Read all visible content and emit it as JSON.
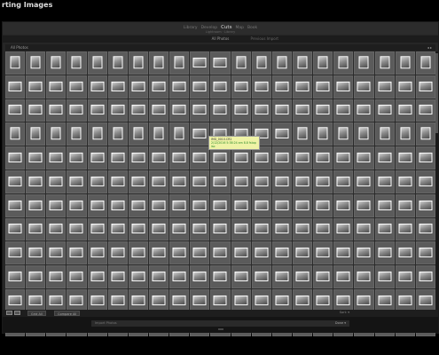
{
  "page": {
    "title": "rting Images"
  },
  "window": {
    "modes": [
      "Library",
      "Develop",
      "Cuts",
      "Map",
      "Book"
    ],
    "active_mode_index": 2,
    "subline": "Lightroom · Library",
    "tabs": [
      "All Photos",
      "Previous Import"
    ],
    "panel_label": "All Photos",
    "panel_control": "◂ ▸"
  },
  "grid": {
    "columns": 21,
    "rows": 12,
    "orientation_rows": [
      "portrait",
      "landscape",
      "landscape",
      "portrait",
      "landscape",
      "landscape",
      "landscape",
      "landscape",
      "landscape",
      "landscape",
      "landscape",
      "landscape"
    ]
  },
  "tooltip": {
    "line1": "IMG_0010.CR2",
    "line2": "2/12/2016 5:38:24 am 8.8 fstop iso"
  },
  "filmstrip": {
    "buttons": [
      "Grid All",
      "Compare All"
    ],
    "sort_label": "Sort: ▾",
    "view_icons": [
      "grid-view-icon",
      "loupe-view-icon"
    ]
  },
  "bottom": {
    "field_text": "Import Photos",
    "done_label": "Done ▾"
  }
}
